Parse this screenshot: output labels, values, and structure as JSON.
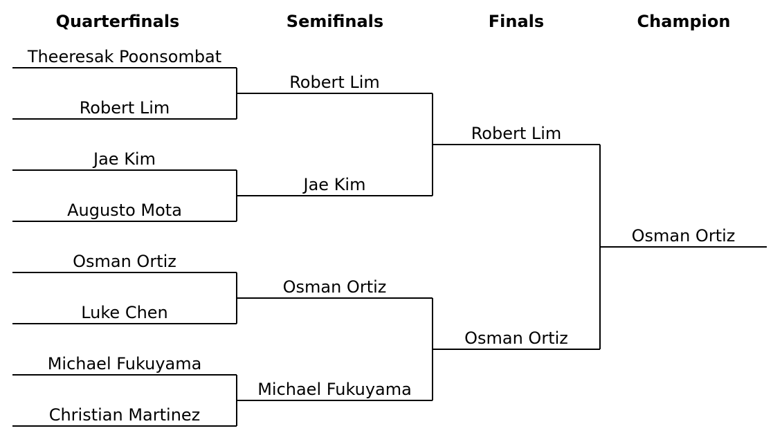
{
  "rounds": [
    "Quarterfinals",
    "Semifinals",
    "Finals",
    "Champion"
  ],
  "quarterfinals": [
    "Theeresak Poonsombat",
    "Robert Lim",
    "Jae Kim",
    "Augusto Mota",
    "Osman Ortiz",
    "Luke Chen",
    "Michael Fukuyama",
    "Christian Martinez"
  ],
  "semifinals": [
    "Robert Lim",
    "Jae Kim",
    "Osman Ortiz",
    "Michael Fukuyama"
  ],
  "finals": [
    "Robert Lim",
    "Osman Ortiz"
  ],
  "champion": "Osman Ortiz",
  "colors": {
    "line": "#000000",
    "text": "#000000",
    "background": "#ffffff"
  }
}
